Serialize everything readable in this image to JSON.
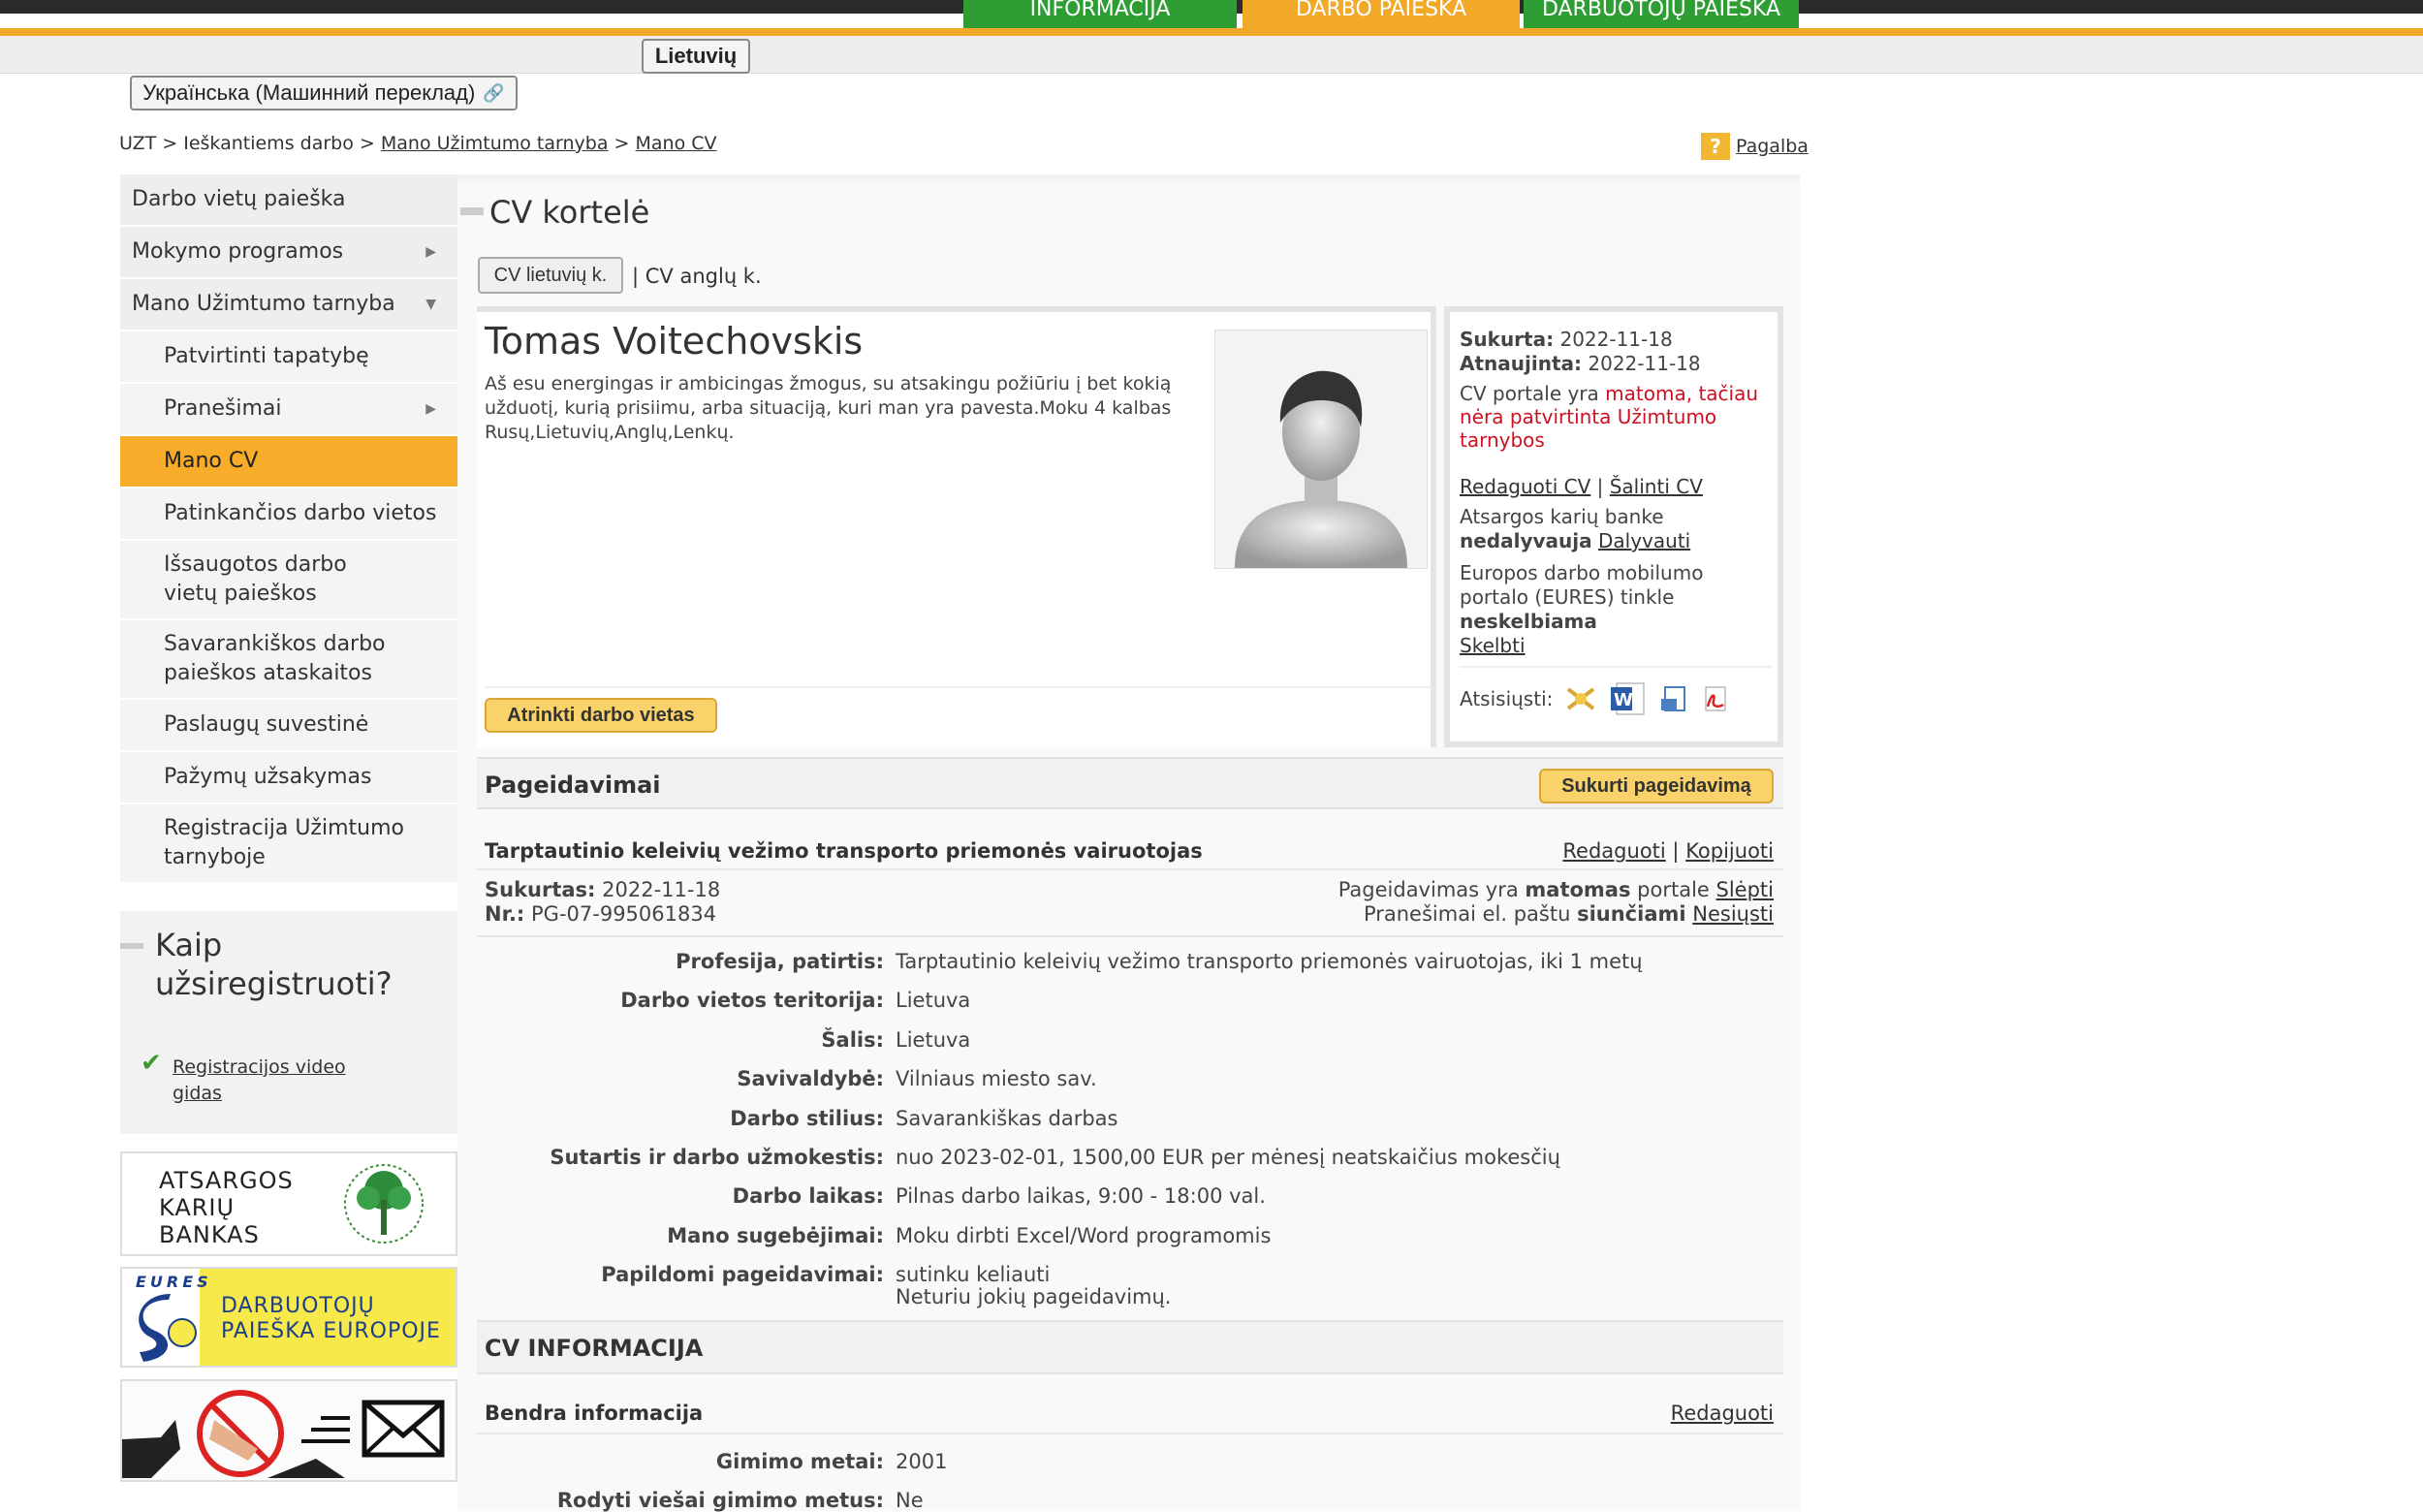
{
  "top_nav": {
    "tabs": [
      {
        "label": "INFORMACIJA",
        "color": "#2e9e34"
      },
      {
        "label": "DARBO PAIEŠKA",
        "color": "#f2a928"
      },
      {
        "label": "DARBUOTOJŲ PAIEŠKA",
        "color": "#2e9e34"
      }
    ],
    "lang_current": "Lietuvių",
    "lang_translate": "Українська (Машинний переклад)"
  },
  "breadcrumb": {
    "items": [
      "UZT",
      "Ieškantiems darbo",
      "Mano Užimtumo tarnyba",
      "Mano CV"
    ],
    "separator": ">"
  },
  "help": {
    "icon": "?",
    "label": "Pagalba"
  },
  "sidebar": {
    "items": [
      {
        "label": "Darbo vietų paieška"
      },
      {
        "label": "Mokymo programos"
      },
      {
        "label": "Mano Užimtumo tarnyba"
      },
      {
        "label": "Patvirtinti tapatybę"
      },
      {
        "label": "Pranešimai"
      },
      {
        "label": "Mano CV"
      },
      {
        "label": "Patinkančios darbo vietos"
      },
      {
        "label": "Išsaugotos darbo vietų paieškos"
      },
      {
        "label": "Savarankiškos darbo paieškos ataskaitos"
      },
      {
        "label": "Paslaugų suvestinė"
      },
      {
        "label": "Pažymų užsakymas"
      },
      {
        "label": "Registracija Užimtumo tarnyboje"
      }
    ],
    "howto_title": "Kaip užsiregistruoti?",
    "howto_link": "Registracijos video gidas",
    "banners": {
      "reserve_line1": "ATSARGOS",
      "reserve_line2": "KARIŲ",
      "reserve_line3": "BANKAS",
      "eures_tag": "EURES",
      "eures_line1": "DARBUOTOJŲ",
      "eures_line2": "PAIEŠKA EUROPOJE"
    }
  },
  "cv": {
    "title": "CV kortelė",
    "tab_lt": "CV lietuvių k.",
    "tab_sep": "|",
    "tab_en": "CV anglų k.",
    "name": "Tomas Voitechovskis",
    "about": "Aš esu energingas ir ambicingas žmogus, su atsakingu požiūriu į bet kokią užduotį, kurią prisiimu, arba situaciją, kuri man yra pavesta.Moku 4 kalbas Rusų,Lietuvių,Anglų,Lenkų.",
    "select_jobs_btn": "Atrinkti darbo vietas",
    "meta": {
      "created_label": "Sukurta:",
      "created_value": "2022-11-18",
      "updated_label": "Atnaujinta:",
      "updated_value": "2022-11-18",
      "visible_pre": "CV portale yra",
      "visible_word": "matoma,",
      "visible_post": "tačiau nėra patvirtinta Užimtumo tarnybos",
      "edit_cv": "Redaguoti CV",
      "delete_cv": "Šalinti CV",
      "link_sep": "|",
      "reserve_text": "Atsargos karių banke",
      "reserve_status": "nedalyvauja",
      "reserve_action": "Dalyvauti",
      "eures_text": "Europos darbo mobilumo portalo (EURES) tinkle",
      "eures_status": "neskelbiama",
      "eures_action": "Skelbti",
      "download_label": "Atsisiųsti:"
    }
  },
  "preferences": {
    "title": "Pageidavimai",
    "create_btn": "Sukurti pageidavimą",
    "item_title": "Tarptautinio keleivių vežimo transporto priemonės vairuotojas",
    "edit": "Redaguoti",
    "copy": "Kopijuoti",
    "sep": "|",
    "created_label": "Sukurtas:",
    "created_value": "2022-11-18",
    "nr_label": "Nr.:",
    "nr_value": "PG-07-995061834",
    "visible_pre": "Pageidavimas yra",
    "visible_word": "matomas",
    "visible_post": "portale",
    "visible_action": "Slėpti",
    "email_pre": "Pranešimai el. paštu",
    "email_word": "siunčiami",
    "email_action": "Nesiųsti",
    "fields": [
      {
        "label": "Profesija, patirtis:",
        "value": "Tarptautinio keleivių vežimo transporto priemonės vairuotojas, iki 1 metų"
      },
      {
        "label": "Darbo vietos teritorija:",
        "value": "Lietuva"
      },
      {
        "label": "Šalis:",
        "value": "Lietuva"
      },
      {
        "label": "Savivaldybė:",
        "value": "Vilniaus miesto sav."
      },
      {
        "label": "Darbo stilius:",
        "value": "Savarankiškas darbas"
      },
      {
        "label": "Sutartis ir darbo užmokestis:",
        "value": "nuo 2023-02-01, 1500,00 EUR per mėnesį neatskaičius mokesčių"
      },
      {
        "label": "Darbo laikas:",
        "value": "Pilnas darbo laikas, 9:00 - 18:00 val."
      },
      {
        "label": "Mano sugebėjimai:",
        "value": "Moku dirbti Excel/Word programomis"
      },
      {
        "label": "Papildomi pageidavimai:",
        "value": "sutinku keliauti",
        "value2": "Neturiu jokių pageidavimų."
      }
    ]
  },
  "cv_info": {
    "title": "CV INFORMACIJA",
    "general_title": "Bendra informacija",
    "edit": "Redaguoti",
    "fields": [
      {
        "label": "Gimimo metai:",
        "value": "2001"
      },
      {
        "label": "Rodyti viešai gimimo metus:",
        "value": "Ne"
      }
    ]
  },
  "colors": {
    "green": "#2e9e34",
    "orange": "#f2a928",
    "active_item": "#f7ac2a",
    "button_yellow": "#f9d36a",
    "red_text": "#cc1122"
  },
  "icons": [
    "shield-icon",
    "word-doc-icon",
    "document-icon",
    "pdf-icon",
    "check-icon",
    "external-link-icon"
  ]
}
